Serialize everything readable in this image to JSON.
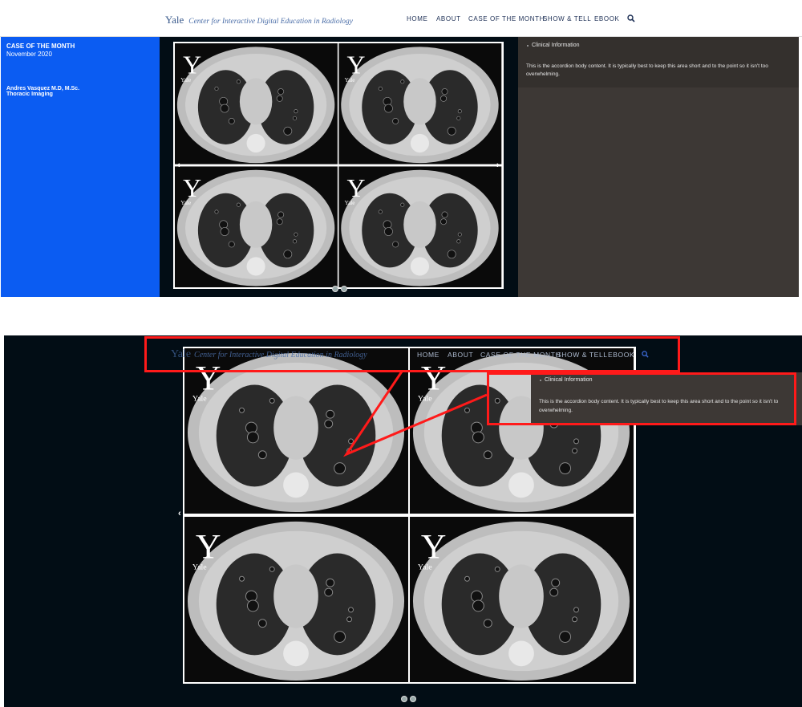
{
  "nav": {
    "brand_yale": "Yale",
    "brand_center": "Center for Interactive Digital Education in Radiology",
    "items": [
      "HOME",
      "ABOUT",
      "CASE OF THE MONTH",
      "SHOW & TELL",
      "EBOOK"
    ],
    "search_icon": "search-icon"
  },
  "case": {
    "title": "CASE OF THE MONTH",
    "date": "November 2020",
    "author": "Andres Vasquez M.D, M.Sc.",
    "department": "Thoracic Imaging"
  },
  "accordion": {
    "title": "Clinical Information",
    "body": "This is the accordion body content. It is typically best to keep this area short and to the point so it isn't too overwhelming."
  },
  "overlay_accordion": {
    "body_line1": "This is the accordion body content. It is typically best to keep this area short and to the point so it isn't to",
    "body_line2": "overwhelming."
  },
  "ct_images": [
    {
      "watermark": "Y",
      "sub": "Yale"
    },
    {
      "watermark": "Y",
      "sub": "Yale"
    },
    {
      "watermark": "Y",
      "sub": "Yale"
    },
    {
      "watermark": "Y",
      "sub": "Yale"
    }
  ],
  "carousel": {
    "slide_count": 2
  },
  "colors": {
    "case_panel": "#0b5cf2",
    "dark_bg": "#020d15",
    "accordion_bg": "#3d3835",
    "annotation": "#ff1a1a"
  }
}
